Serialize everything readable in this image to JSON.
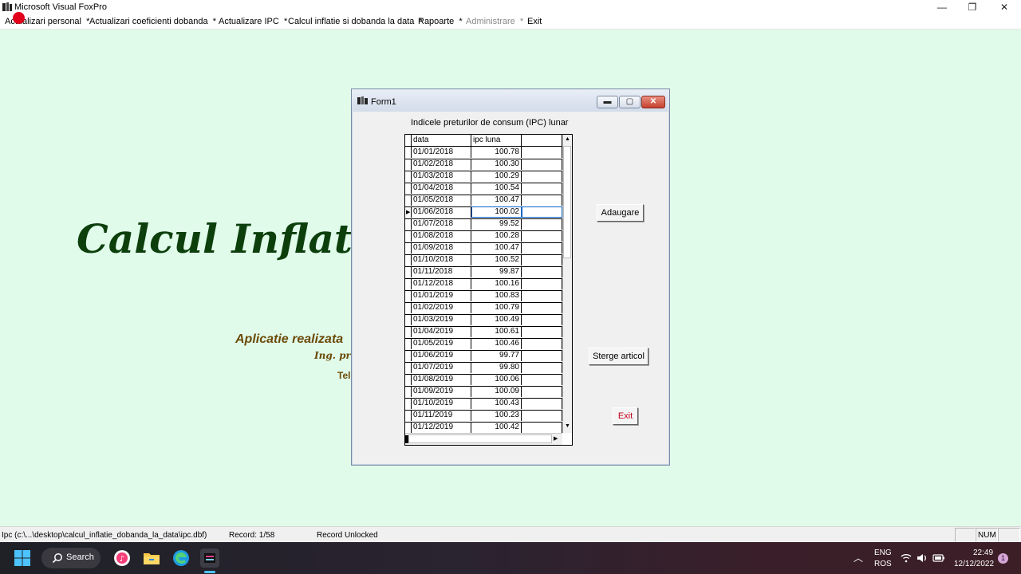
{
  "window": {
    "title": "Microsoft Visual FoxPro",
    "controls": {
      "minimize": "—",
      "restore": "❐",
      "close": "✕"
    }
  },
  "menu": [
    {
      "label": "Actualizari personal",
      "arrow": "*",
      "enabled": true
    },
    {
      "label": "Actualizari coeficienti  dobanda",
      "arrow": "*",
      "enabled": true
    },
    {
      "label": "Actualizare IPC",
      "arrow": "*",
      "enabled": true
    },
    {
      "label": "Calcul inflatie si dobanda la data",
      "arrow": "*",
      "enabled": true
    },
    {
      "label": "Rapoarte",
      "arrow": "*",
      "enabled": true
    },
    {
      "label": "Administrare",
      "arrow": "*",
      "enabled": false
    },
    {
      "label": "Exit",
      "arrow": "",
      "enabled": true
    }
  ],
  "background": {
    "title": "Calcul Inflati",
    "line1": "Aplicatie realizata",
    "line2": "Ing. pr",
    "line3": "Tel"
  },
  "form": {
    "caption": "Form1",
    "grid_caption": "Indicele preturilor de consum (IPC)  lunar",
    "columns": [
      "data",
      "ipc luna"
    ],
    "current_row_index": 5,
    "rows": [
      [
        "01/01/2018",
        "100.78"
      ],
      [
        "01/02/2018",
        "100.30"
      ],
      [
        "01/03/2018",
        "100.29"
      ],
      [
        "01/04/2018",
        "100.54"
      ],
      [
        "01/05/2018",
        "100.47"
      ],
      [
        "01/06/2018",
        "100.02"
      ],
      [
        "01/07/2018",
        "99.52"
      ],
      [
        "01/08/2018",
        "100.28"
      ],
      [
        "01/09/2018",
        "100.47"
      ],
      [
        "01/10/2018",
        "100.52"
      ],
      [
        "01/11/2018",
        "99.87"
      ],
      [
        "01/12/2018",
        "100.16"
      ],
      [
        "01/01/2019",
        "100.83"
      ],
      [
        "01/02/2019",
        "100.79"
      ],
      [
        "01/03/2019",
        "100.49"
      ],
      [
        "01/04/2019",
        "100.61"
      ],
      [
        "01/05/2019",
        "100.46"
      ],
      [
        "01/06/2019",
        "99.77"
      ],
      [
        "01/07/2019",
        "99.80"
      ],
      [
        "01/08/2019",
        "100.06"
      ],
      [
        "01/09/2019",
        "100.09"
      ],
      [
        "01/10/2019",
        "100.43"
      ],
      [
        "01/11/2019",
        "100.23"
      ],
      [
        "01/12/2019",
        "100.42"
      ]
    ],
    "buttons": {
      "add": "Adaugare",
      "delete": "Sterge articol",
      "exit": "Exit"
    }
  },
  "status": {
    "path": "Ipc (c:\\...\\desktop\\calcul_inflatie_dobanda_la_data\\ipc.dbf)",
    "record": "Record: 1/58",
    "lock": "Record Unlocked",
    "num": "NUM"
  },
  "taskbar": {
    "search_label": "Search",
    "lang1": "ENG",
    "lang2": "ROS",
    "time": "22:49",
    "date": "12/12/2022",
    "notification_count": "1"
  },
  "colors": {
    "desktop_bg": "#e0fbea",
    "title_green": "#0c3f0c",
    "subtitle_brown": "#6b4a08",
    "exit_red": "#c00018"
  }
}
